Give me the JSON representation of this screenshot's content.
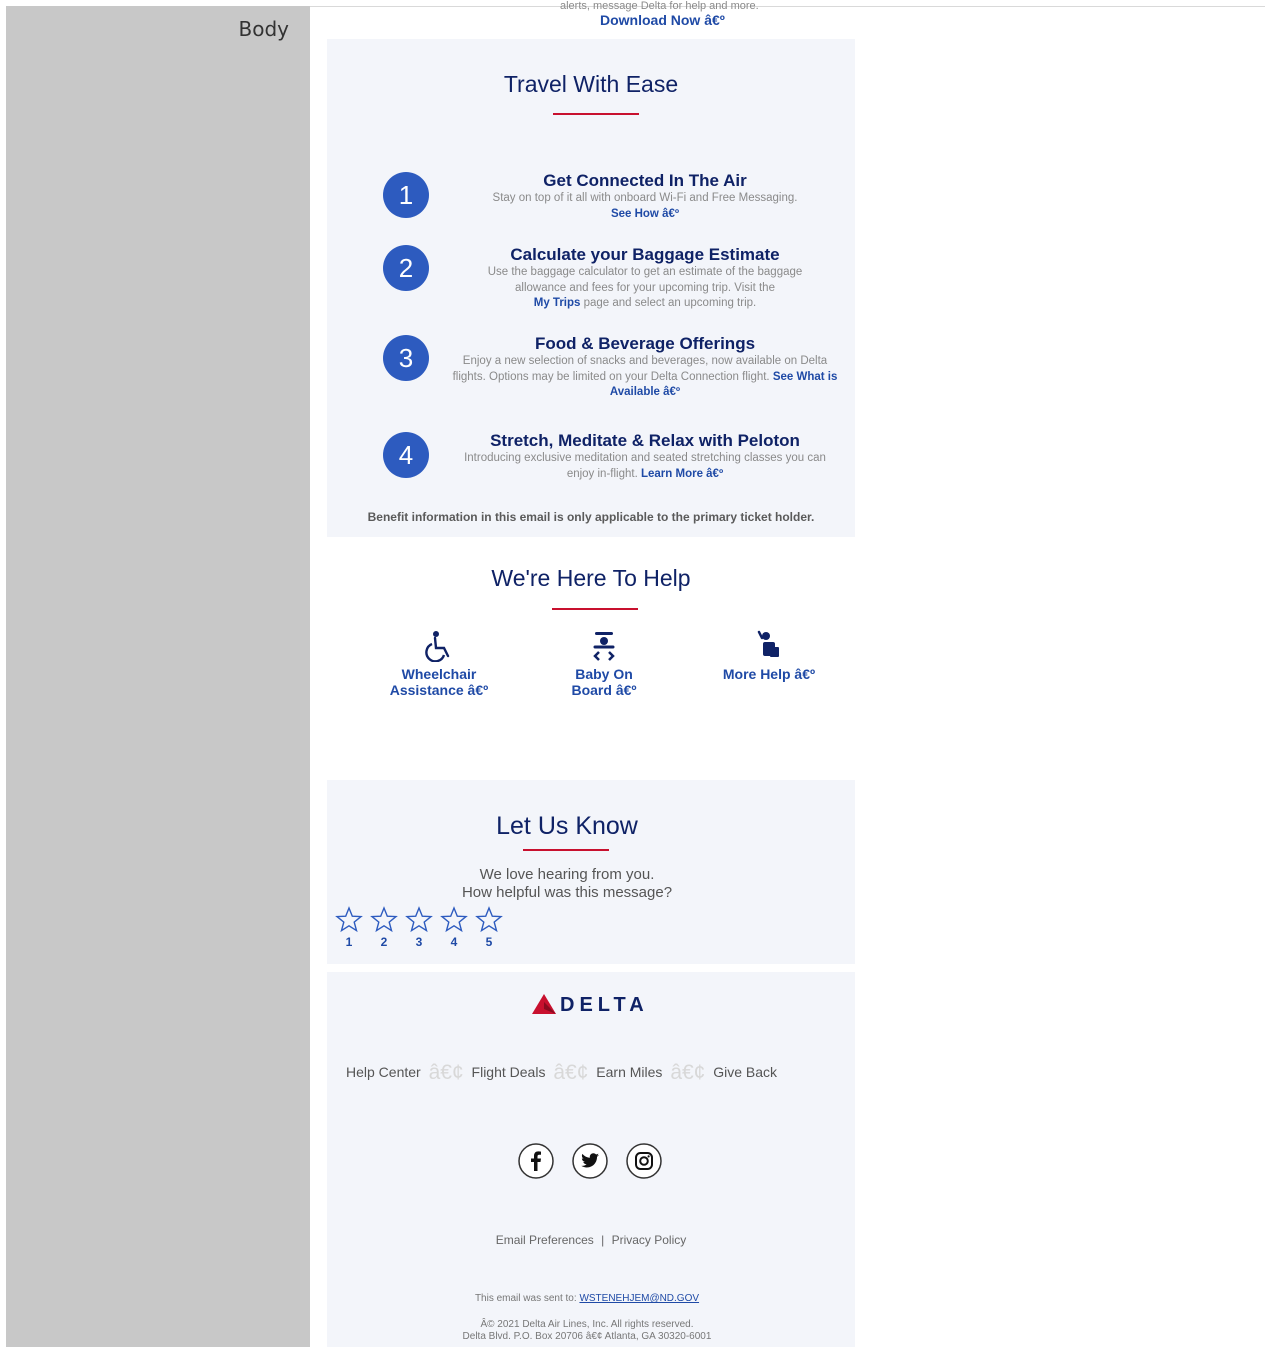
{
  "panel": {
    "label": "Body"
  },
  "top": {
    "partial_text": "alerts, message Delta for help and more.",
    "download_link": "Download Now â€º"
  },
  "travel": {
    "title": "Travel With Ease",
    "steps": [
      {
        "number": "1",
        "title": "Get Connected In The Air",
        "body": "Stay on top of it all with onboard Wi-Fi and Free Messaging.",
        "link": "See How â€º"
      },
      {
        "number": "2",
        "title": "Calculate your Baggage Estimate",
        "body_line1": "Use the baggage calculator to get an estimate of the baggage",
        "body_line2": "allowance and fees for your upcoming trip. Visit the",
        "link": "My Trips",
        "body_after": " page and select an upcoming trip."
      },
      {
        "number": "3",
        "title": "Food & Beverage Offerings",
        "body_line1": "Enjoy a new selection of snacks and beverages, now available on Delta",
        "body_line2": "flights. Options may be limited on your Delta Connection flight.",
        "link": "See What is Available â€º"
      },
      {
        "number": "4",
        "title": "Stretch, Meditate & Relax with Peloton",
        "body_line1": "Introducing exclusive meditation and seated stretching classes you can",
        "body_line2": "enjoy in-flight.",
        "link": "Learn More â€º"
      }
    ],
    "benefit_note": "Benefit information in this email is only applicable to the primary ticket holder."
  },
  "help": {
    "title": "We're Here To Help",
    "items": [
      {
        "line1": "Wheelchair",
        "line2": "Assistance â€º",
        "icon": "wheelchair-icon"
      },
      {
        "line1": "Baby On",
        "line2": "Board â€º",
        "icon": "baby-icon"
      },
      {
        "line1": "More Help â€º",
        "line2": "",
        "icon": "help-person-icon"
      }
    ]
  },
  "feedback": {
    "title": "Let Us Know",
    "line1": "We love hearing from you.",
    "line2": "How helpful was this message?",
    "ratings": [
      "1",
      "2",
      "3",
      "4",
      "5"
    ]
  },
  "footer": {
    "brand": "DELTA",
    "nav": [
      "Help Center",
      "Flight Deals",
      "Earn Miles",
      "Give Back"
    ],
    "separator": "â€¢",
    "social": [
      "facebook-icon",
      "twitter-icon",
      "instagram-icon"
    ],
    "legal_links": [
      "Email Preferences",
      "Privacy Policy"
    ],
    "legal_sep": "|",
    "sent_to_label": "This email was sent to:",
    "sent_to_email": "WSTENEHJEM@ND.GOV",
    "copyright": "Â© 2021 Delta Air Lines, Inc. All rights reserved.",
    "address": "Delta Blvd. P.O. Box 20706 â€¢ Atlanta, GA 30320-6001"
  },
  "colors": {
    "navy": "#0f2266",
    "link_blue": "#1f4aa6",
    "circle_blue": "#2d5bbf",
    "accent_red": "#c8102e",
    "section_bg": "#f3f5fa",
    "panel_gray": "#c8c8c8"
  }
}
